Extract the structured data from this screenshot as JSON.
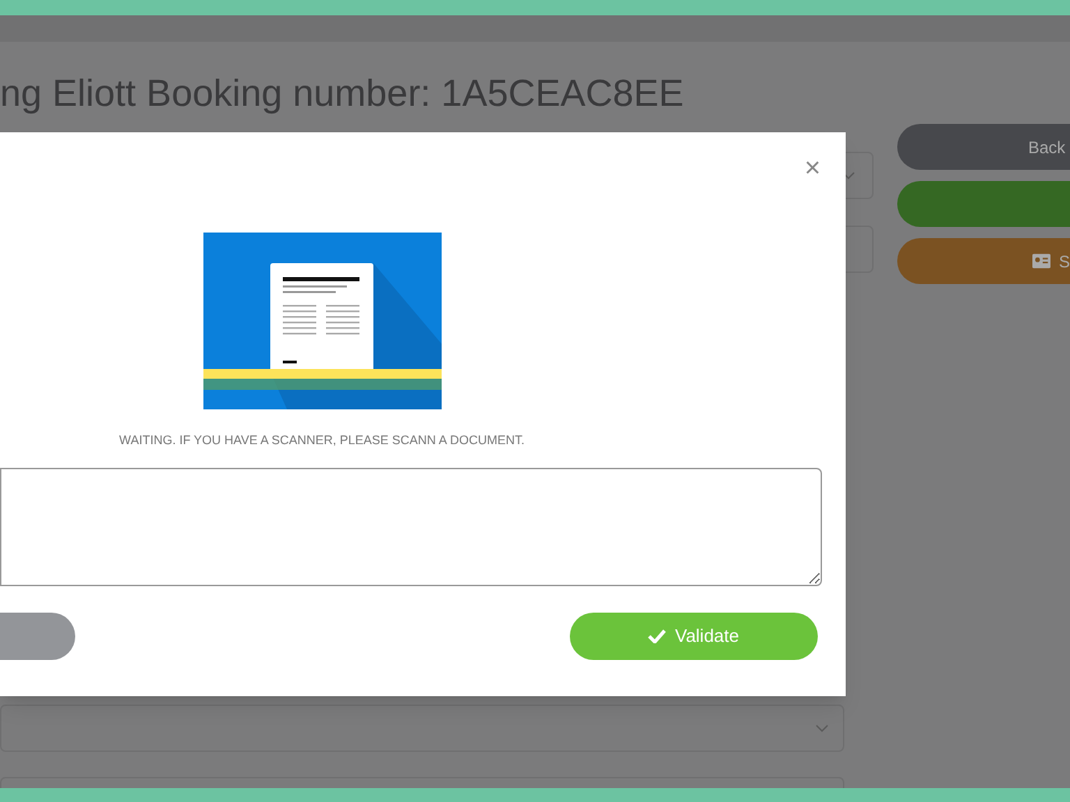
{
  "page": {
    "title": "ng Eliott Booking number: 1A5CEAC8EE"
  },
  "side_buttons": [
    {
      "kind": "back",
      "label": "Back"
    },
    {
      "kind": "confirm"
    },
    {
      "kind": "scan",
      "label": "S"
    }
  ],
  "modal": {
    "close": "×",
    "caption": "WAITING. IF YOU HAVE A SCANNER, PLEASE SCANN A DOCUMENT.",
    "validate": "Validate"
  }
}
